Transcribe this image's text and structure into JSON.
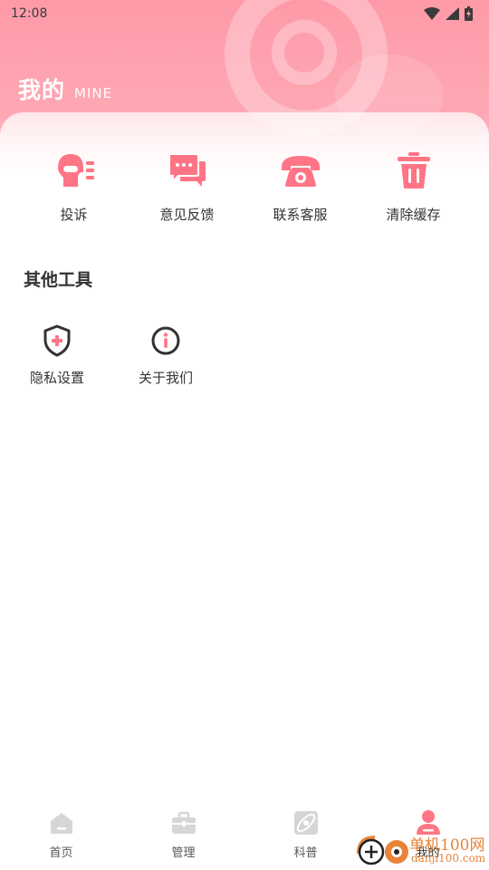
{
  "status_bar": {
    "time": "12:08",
    "icons": [
      "wifi-icon",
      "signal-icon",
      "battery-icon"
    ]
  },
  "header": {
    "title": "我的",
    "subtitle": "MINE"
  },
  "quick_actions": [
    {
      "label": "投诉",
      "icon": "complaint-icon"
    },
    {
      "label": "意见反馈",
      "icon": "chat-feedback-icon"
    },
    {
      "label": "联系客服",
      "icon": "telephone-icon"
    },
    {
      "label": "清除缓存",
      "icon": "trash-icon"
    }
  ],
  "other_tools": {
    "title": "其他工具",
    "items": [
      {
        "label": "隐私设置",
        "icon": "shield-plus-icon"
      },
      {
        "label": "关于我们",
        "icon": "info-icon"
      }
    ]
  },
  "bottom_nav": [
    {
      "label": "首页",
      "icon": "home-icon",
      "active": false
    },
    {
      "label": "管理",
      "icon": "briefcase-icon",
      "active": false
    },
    {
      "label": "科普",
      "icon": "science-icon",
      "active": false
    },
    {
      "label": "我的",
      "icon": "user-icon",
      "active": true
    }
  ],
  "watermark": {
    "line1": "单机100网",
    "line2": "danji100.com"
  },
  "colors": {
    "accent": "#ff7585",
    "header": "#fea8b4",
    "nav_inactive": "#d6d6d6",
    "watermark": "#e8833a"
  }
}
